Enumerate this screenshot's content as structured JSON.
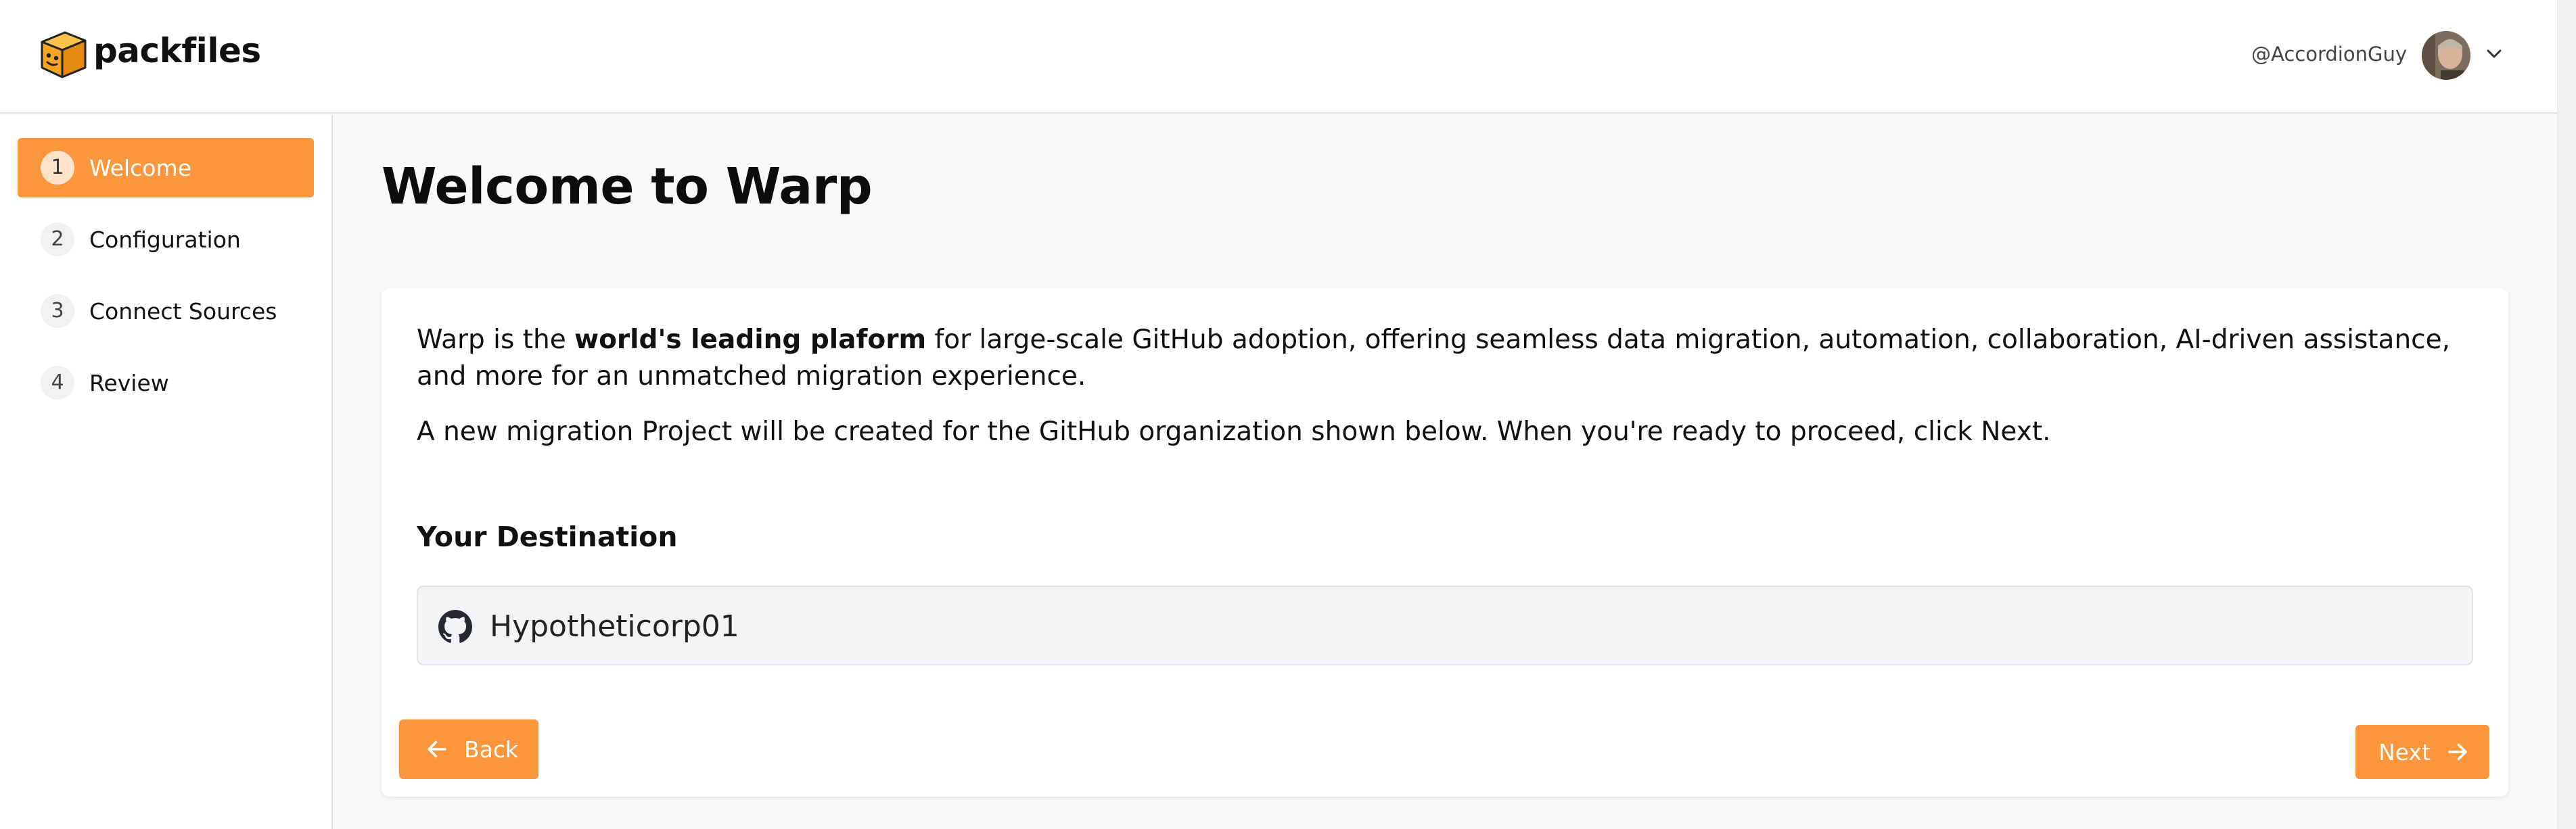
{
  "header": {
    "brand": "packfiles",
    "username": "@AccordionGuy"
  },
  "sidebar": {
    "steps": [
      {
        "number": "1",
        "label": "Welcome",
        "active": true
      },
      {
        "number": "2",
        "label": "Configuration",
        "active": false
      },
      {
        "number": "3",
        "label": "Connect Sources",
        "active": false
      },
      {
        "number": "4",
        "label": "Review",
        "active": false
      }
    ]
  },
  "main": {
    "title": "Welcome to Warp",
    "intro": {
      "prefix": "Warp is the ",
      "bold": "world's leading plaform",
      "suffix": " for large-scale GitHub adoption, offering seamless data migration, automation, collaboration, AI-driven assistance, and more for an unmatched migration experience."
    },
    "instructions": "A new migration Project will be created for the GitHub organization shown below. When you're ready to proceed, click Next.",
    "destination_heading": "Your Destination",
    "destination_name": "Hypotheticorp01",
    "destination_icon": "github-icon",
    "back_label": "Back",
    "next_label": "Next"
  },
  "colors": {
    "accent": "#fc963c",
    "background": "#f9f9f9"
  }
}
